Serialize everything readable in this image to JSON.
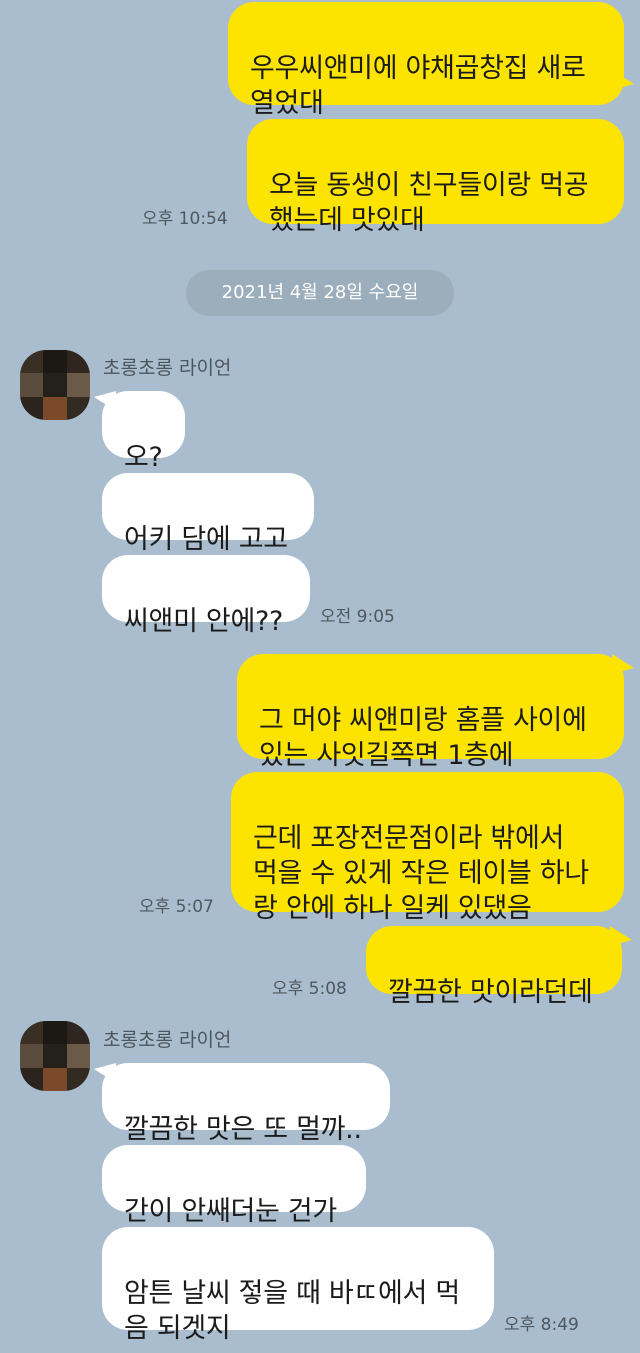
{
  "colors": {
    "background": "#a9bdce",
    "outgoing_bubble": "#fde400",
    "incoming_bubble": "#ffffff",
    "date_pill": "#9cadbc"
  },
  "messages_top": {
    "msg1": "우우씨앤미에 야채곱창집 새로\n열었대",
    "msg2": "오늘 동생이 친구들이랑 먹공\n했는데 맛있대",
    "time": "오후 10:54"
  },
  "date_divider": "2021년 4월 28일 수요일",
  "group1": {
    "sender": "초롱초롱 라이언",
    "msg1": "오?",
    "msg2": "어키 담에 고고",
    "msg3": "씨앤미 안에??",
    "time": "오전 9:05"
  },
  "reply1": {
    "msg1": "그 머야 씨앤미랑 홈플 사이에\n있는 사잇길쪽면 1층에",
    "msg2": "근데 포장전문점이라 밖에서\n먹을 수 있게 작은 테이블 하나\n랑 안에 하나 일케 있댔음",
    "time": "오후 5:07"
  },
  "reply2": {
    "msg": "깔끔한 맛이라던데",
    "time": "오후 5:08"
  },
  "group2": {
    "sender": "초롱초롱 라이언",
    "msg1": "깔끔한 맛은 또 멀까..",
    "msg2": "간이 안쌔더눈 건가",
    "msg3": "암튼 날씨 젛을 때 바ㄸ에서 먹\n음 되겟지",
    "time": "오후 8:49"
  }
}
